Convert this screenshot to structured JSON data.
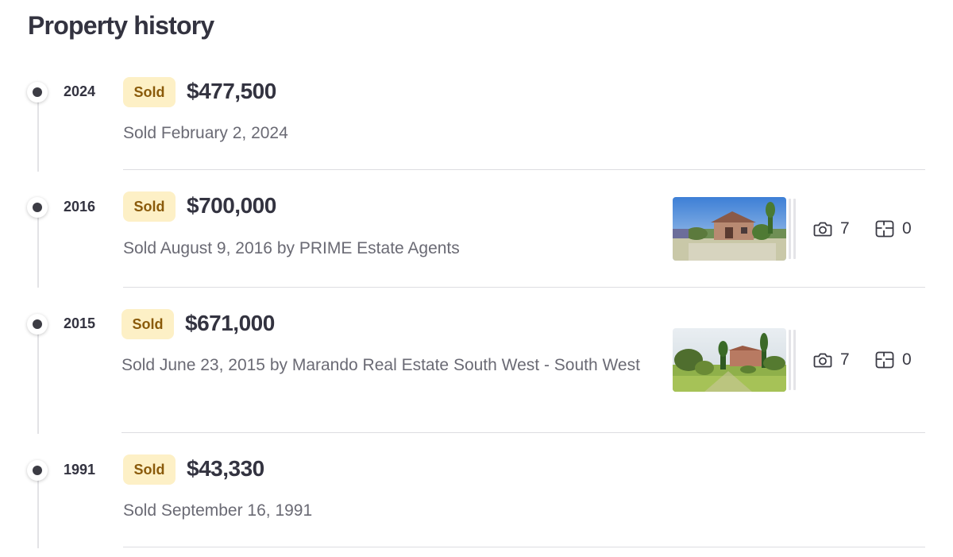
{
  "page": {
    "title": "Property history"
  },
  "history": [
    {
      "year": "2024",
      "badge": "Sold",
      "price": "$477,500",
      "description": "Sold February 2, 2024"
    },
    {
      "year": "2016",
      "badge": "Sold",
      "price": "$700,000",
      "description": "Sold August 9, 2016 by PRIME Estate Agents",
      "photo_count": "7",
      "floorplan_count": "0"
    },
    {
      "year": "2015",
      "badge": "Sold",
      "price": "$671,000",
      "description": "Sold June 23, 2015 by Marando Real Estate South West - South West",
      "photo_count": "7",
      "floorplan_count": "0"
    },
    {
      "year": "1991",
      "badge": "Sold",
      "price": "$43,330",
      "description": "Sold September 16, 1991"
    }
  ],
  "colors": {
    "badge_background": "#fdf0c6",
    "badge_text": "#8a5a0a",
    "timeline_dot": "#3c3c44",
    "description_text": "#6a6a74"
  },
  "icons": {
    "photos": "camera-icon",
    "floorplans": "floorplan-icon"
  }
}
